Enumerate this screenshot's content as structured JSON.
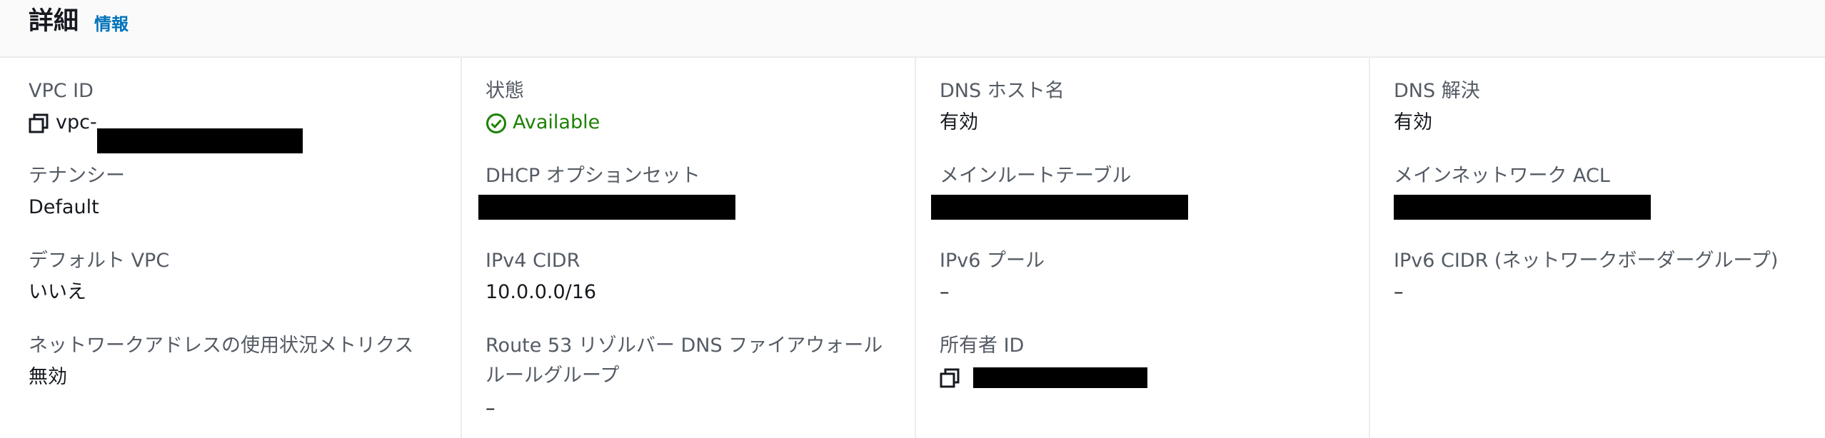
{
  "header": {
    "title": "詳細",
    "info_link": "情報"
  },
  "columns": [
    {
      "fields": [
        {
          "label": "VPC ID",
          "value": "vpc-"
        },
        {
          "label": "テナンシー",
          "value": "Default"
        },
        {
          "label": "デフォルト VPC",
          "value": "いいえ"
        },
        {
          "label": "ネットワークアドレスの使用状況メトリクス",
          "value": "無効"
        }
      ]
    },
    {
      "fields": [
        {
          "label": "状態",
          "value": "Available"
        },
        {
          "label": "DHCP オプションセット",
          "value": ""
        },
        {
          "label": "IPv4 CIDR",
          "value": "10.0.0.0/16"
        },
        {
          "label": "Route 53 リゾルバー DNS ファイアウォール",
          "label_line2": "ルールグループ",
          "value": "–"
        }
      ]
    },
    {
      "fields": [
        {
          "label": "DNS ホスト名",
          "value": "有効"
        },
        {
          "label": "メインルートテーブル",
          "value": ""
        },
        {
          "label": "IPv6 プール",
          "value": "–"
        },
        {
          "label": "所有者 ID",
          "value": ""
        }
      ]
    },
    {
      "fields": [
        {
          "label": "DNS 解決",
          "value": "有効"
        },
        {
          "label": "メインネットワーク ACL",
          "value": ""
        },
        {
          "label": "IPv6 CIDR (ネットワークボーダーグループ)",
          "value": "–"
        }
      ]
    }
  ],
  "colors": {
    "status_ok": "#1d8102",
    "link": "#0073bb",
    "label": "#545b64"
  },
  "icons": {
    "copy": "copy-icon",
    "status": "check-circle-icon"
  }
}
